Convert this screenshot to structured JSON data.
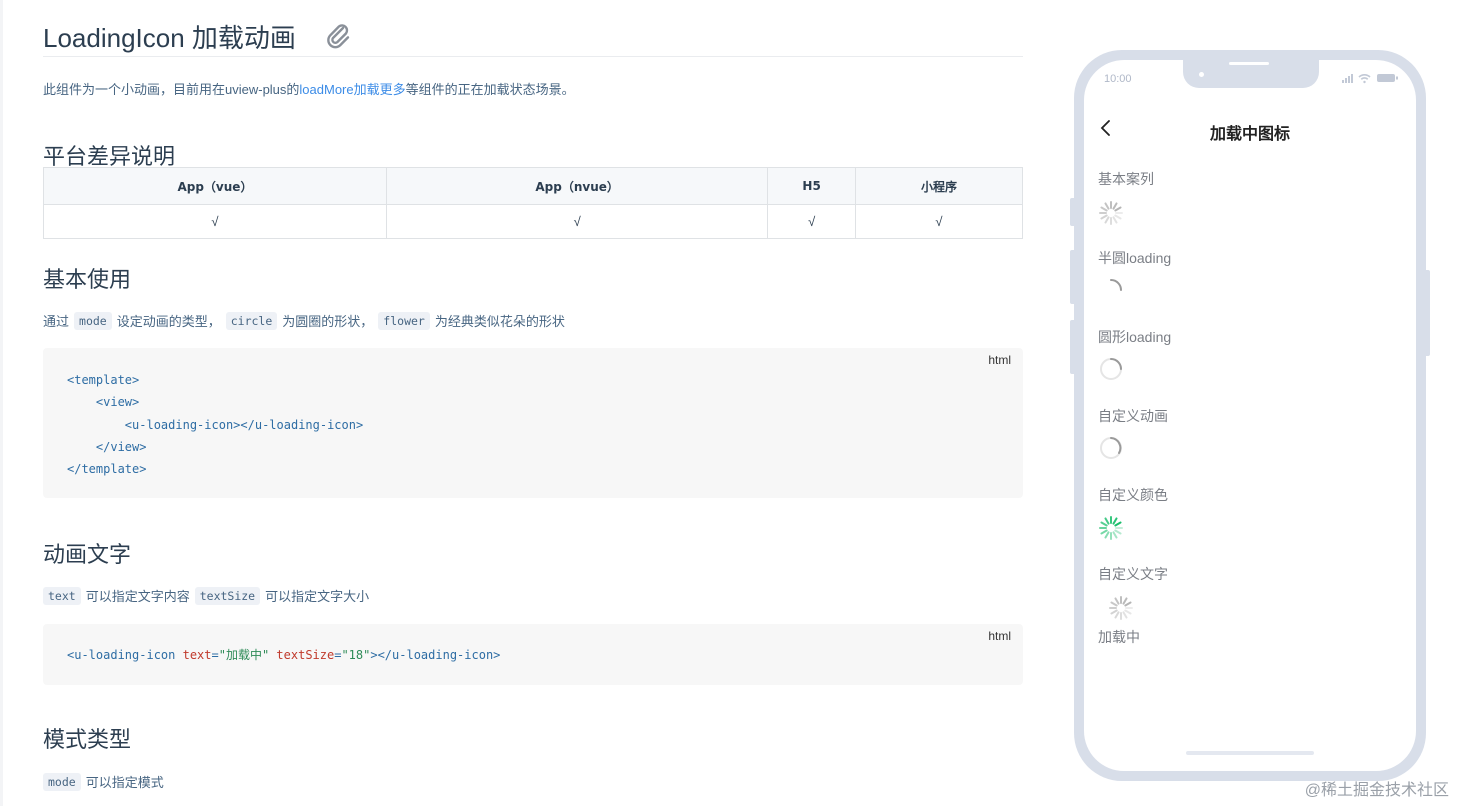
{
  "doc": {
    "title": "LoadingIcon 加载动画",
    "intro": {
      "before": "此组件为一个小动画，目前用在uview-plus的",
      "link": "loadMore加载更多",
      "after": "等组件的正在加载状态场景。"
    },
    "sections": {
      "platform": {
        "heading": "平台差异说明",
        "headers": [
          "App（vue）",
          "App（nvue）",
          "H5",
          "小程序"
        ],
        "row": [
          "√",
          "√",
          "√",
          "√"
        ]
      },
      "basic": {
        "heading": "基本使用",
        "text_1": "通过",
        "code_1": "mode",
        "text_2": "设定动画的类型，",
        "code_2": "circle",
        "text_3": "为圆圈的形状，",
        "code_3": "flower",
        "text_4": "为经典类似花朵的形状",
        "code_lang": "html",
        "code_lines": [
          "<template>",
          "    <view>",
          "        <u-loading-icon></u-loading-icon>",
          "    </view>",
          "</template>"
        ]
      },
      "text": {
        "heading": "动画文字",
        "code_1": "text",
        "text_1": "可以指定文字内容",
        "code_2": "textSize",
        "text_2": "可以指定文字大小",
        "code_lang": "html",
        "code_tag_open": "<u-loading-icon ",
        "code_attr_1": "text",
        "code_eq_1": "=",
        "code_val_1": "\"加载中\"",
        "code_sp": " ",
        "code_attr_2": "textSize",
        "code_eq_2": "=",
        "code_val_2": "\"18\"",
        "code_tag_close": "></u-loading-icon>"
      },
      "mode": {
        "heading": "模式类型",
        "code_1": "mode",
        "text_1": "可以指定模式"
      }
    }
  },
  "phone": {
    "status_time": "10:00",
    "nav_title": "加载中图标",
    "demos": [
      {
        "label": "基本案列",
        "icon": "flower-spinner-icon"
      },
      {
        "label": "半圆loading",
        "icon": "semicircle-spinner-icon"
      },
      {
        "label": "圆形loading",
        "icon": "circle-spinner-icon"
      },
      {
        "label": "自定义动画",
        "icon": "circle-spinner-icon"
      },
      {
        "label": "自定义颜色",
        "icon": "flower-spinner-green-icon"
      },
      {
        "label": "自定义文字",
        "icon": "flower-spinner-icon"
      }
    ],
    "demo_text": "加载中"
  },
  "colors": {
    "accent_green": "#19be6b",
    "link_blue": "#3c8ce7",
    "spinner_gray": "#b5b5b5"
  },
  "watermark": "@稀土掘金技术社区"
}
